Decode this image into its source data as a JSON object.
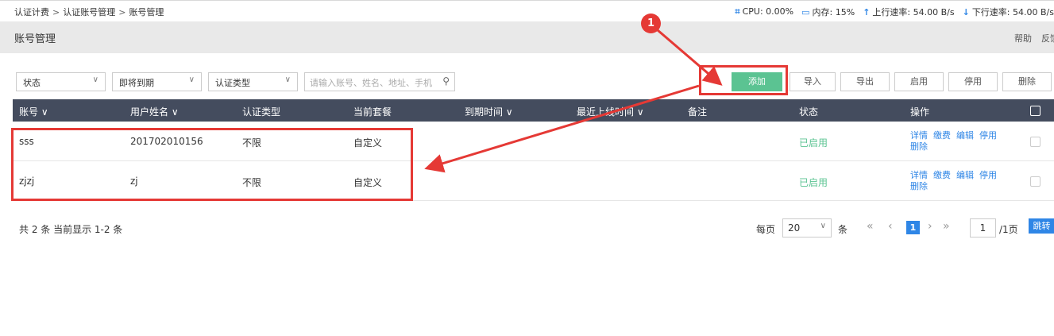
{
  "breadcrumb": [
    "认证计费",
    "认证账号管理",
    "账号管理"
  ],
  "system": {
    "cpu": "CPU: 0.00%",
    "memory": "内存: 15%",
    "up": "上行速率: 54.00 B/s",
    "down": "下行速率: 54.00 B/s"
  },
  "header": {
    "title": "账号管理",
    "help": "帮助",
    "feedback": "反馈"
  },
  "filters": {
    "status": "状态",
    "expiring": "即将到期",
    "auth_type": "认证类型",
    "search_placeholder": "请输入账号、姓名、地址、手机"
  },
  "toolbar": {
    "add": "添加",
    "import": "导入",
    "export": "导出",
    "enable": "启用",
    "disable": "停用",
    "delete": "删除"
  },
  "table": {
    "columns": [
      "账号 ∨",
      "用户姓名 ∨",
      "认证类型",
      "当前套餐",
      "到期时间 ∨",
      "最近上线时间 ∨",
      "备注",
      "状态",
      "操作"
    ],
    "rows": [
      {
        "account": "sss",
        "name": "201702010156",
        "auth_type": "不限",
        "package": "自定义",
        "expire": "",
        "last_online": "",
        "note": "",
        "status": "已启用"
      },
      {
        "account": "zjzj",
        "name": "zj",
        "auth_type": "不限",
        "package": "自定义",
        "expire": "",
        "last_online": "",
        "note": "",
        "status": "已启用"
      }
    ],
    "ops": {
      "detail": "详情",
      "pay": "缴费",
      "edit": "编辑",
      "disable": "停用",
      "delete": "删除"
    }
  },
  "footer": {
    "summary": "共 2 条 当前显示 1-2 条"
  },
  "pagination": {
    "per_page_label": "每页",
    "per_page": "20",
    "unit": "条",
    "current_page": "1",
    "page_input": "1",
    "total_pages": "/1页",
    "jump": "跳转"
  },
  "annotation": {
    "badge": "1"
  },
  "colors": {
    "accent": "#5bc392",
    "header_bg": "#444c5e",
    "link": "#2f86e6",
    "annotation": "#e53935"
  }
}
